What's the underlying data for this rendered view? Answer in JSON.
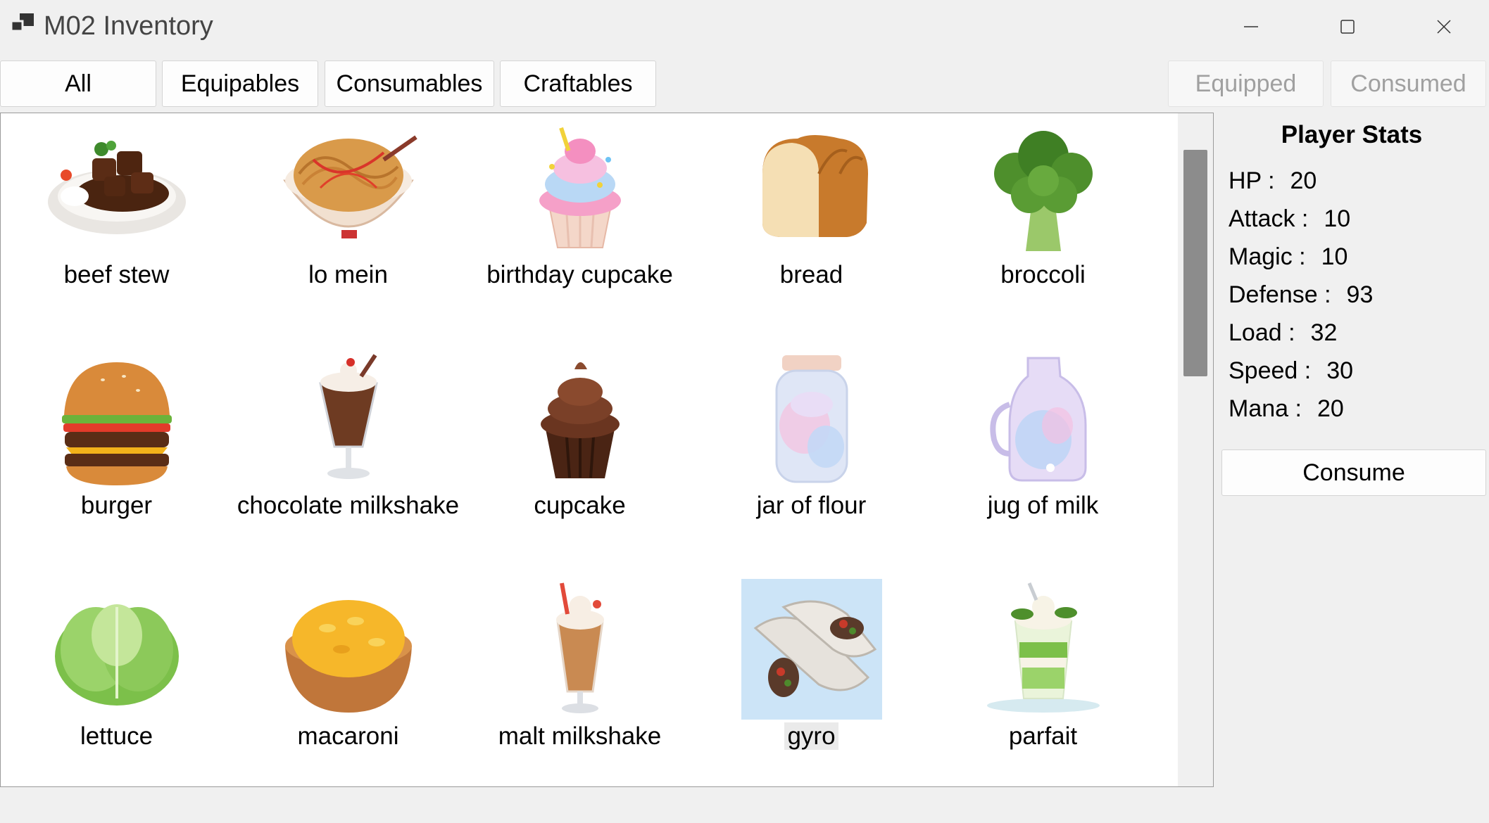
{
  "window": {
    "title": "M02 Inventory",
    "icons": [
      "app-icon",
      "minimize-icon",
      "maximize-icon",
      "close-icon"
    ]
  },
  "tabs": {
    "all": "All",
    "equipables": "Equipables",
    "consumables": "Consumables",
    "craftables": "Craftables",
    "equipped": "Equipped",
    "consumed": "Consumed"
  },
  "items": [
    {
      "label": "beef stew",
      "icon": "beef-stew-icon"
    },
    {
      "label": "lo mein",
      "icon": "lo-mein-icon"
    },
    {
      "label": "birthday cupcake",
      "icon": "birthday-cupcake-icon"
    },
    {
      "label": "bread",
      "icon": "bread-icon"
    },
    {
      "label": "broccoli",
      "icon": "broccoli-icon"
    },
    {
      "label": "burger",
      "icon": "burger-icon"
    },
    {
      "label": "chocolate milkshake",
      "icon": "chocolate-milkshake-icon"
    },
    {
      "label": "cupcake",
      "icon": "cupcake-icon"
    },
    {
      "label": "jar of flour",
      "icon": "jar-of-flour-icon"
    },
    {
      "label": "jug of milk",
      "icon": "jug-of-milk-icon"
    },
    {
      "label": "lettuce",
      "icon": "lettuce-icon"
    },
    {
      "label": "macaroni",
      "icon": "macaroni-icon"
    },
    {
      "label": "malt milkshake",
      "icon": "malt-milkshake-icon"
    },
    {
      "label": "gyro",
      "icon": "gyro-icon",
      "selected": true
    },
    {
      "label": "parfait",
      "icon": "parfait-icon"
    }
  ],
  "stats": {
    "title": "Player Stats",
    "rows": [
      {
        "label": "HP :",
        "value": "20"
      },
      {
        "label": "Attack :",
        "value": "10"
      },
      {
        "label": "Magic :",
        "value": "10"
      },
      {
        "label": "Defense :",
        "value": "93"
      },
      {
        "label": "Load :",
        "value": "32"
      },
      {
        "label": "Speed :",
        "value": "30"
      },
      {
        "label": "Mana :",
        "value": "20"
      }
    ],
    "consume_label": "Consume"
  },
  "colors": {
    "selection": "#cce4f7",
    "window_bg": "#f0f0f0",
    "disabled_text": "#a0a0a0"
  }
}
